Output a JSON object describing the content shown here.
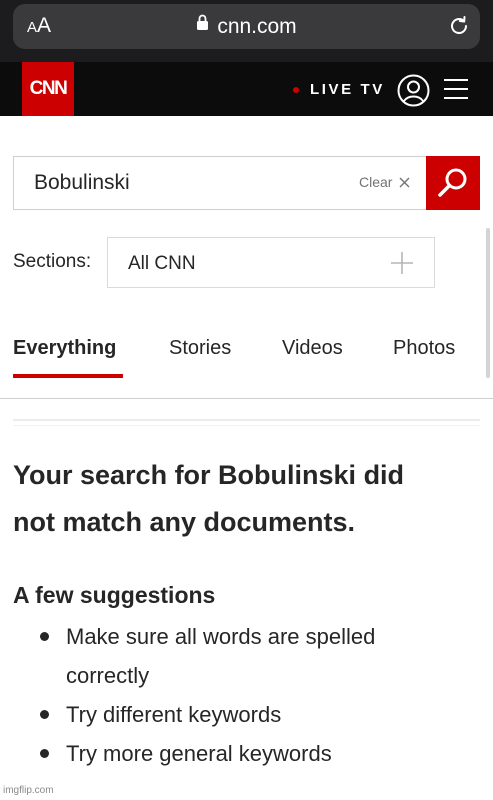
{
  "browser": {
    "text_size_label": "AA",
    "url": "cnn.com",
    "lock_icon": "lock-icon",
    "reload_icon": "reload-icon"
  },
  "header": {
    "logo_text": "CNN",
    "live_tv_label": "LIVE TV",
    "live_dot_color": "#cc0000",
    "brand_color": "#cc0000"
  },
  "search": {
    "value": "Bobulinski",
    "clear_label": "Clear"
  },
  "sections": {
    "label": "Sections:",
    "value": "All CNN"
  },
  "tabs": [
    {
      "label": "Everything",
      "active": true
    },
    {
      "label": "Stories",
      "active": false
    },
    {
      "label": "Videos",
      "active": false
    },
    {
      "label": "Photos",
      "active": false
    }
  ],
  "results": {
    "no_match_line1": "Your search for Bobulinski did",
    "no_match_line2": "not match any documents.",
    "suggestions_title": "A few suggestions",
    "suggestions": [
      "Make sure all words are spelled correctly",
      "Try different keywords",
      "Try more general keywords"
    ]
  },
  "watermark": "imgflip.com"
}
